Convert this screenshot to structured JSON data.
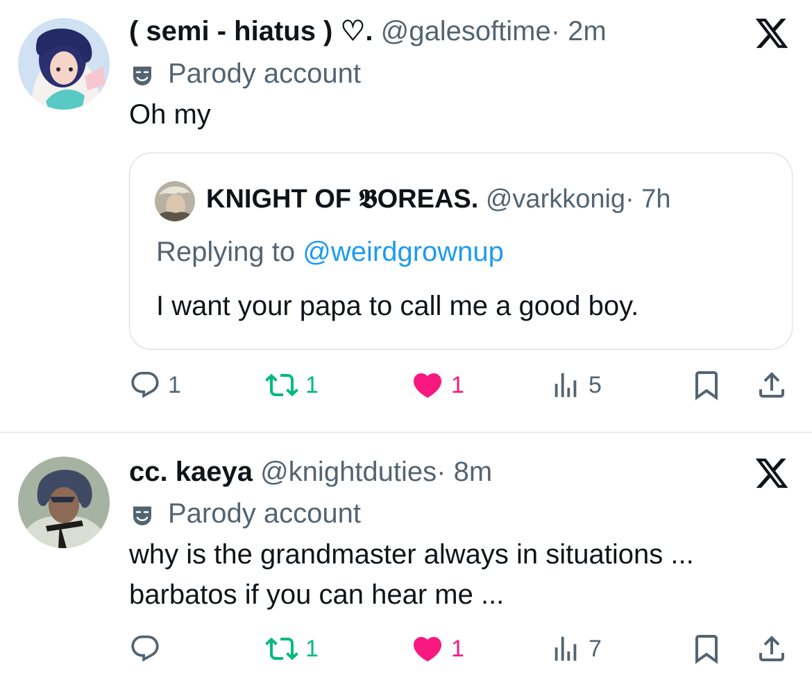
{
  "posts": [
    {
      "display_name": "( semi - hiatus ) ♡.",
      "handle": "@galesoftime",
      "time": "· 2m",
      "badge": "Parody account",
      "text_lines": [
        "Oh my"
      ],
      "avatar_icon": "avatar-icon",
      "quote": {
        "display_name": "KNIGHT OF 𝕭OREAS.",
        "handle": "@varkkonig",
        "time": "· 7h",
        "replying_prefix": "Replying to",
        "replying_to": "@weirdgrownup",
        "text": "I want your papa to call me a good boy."
      },
      "stats": {
        "replies": "1",
        "reposts": "1",
        "likes": "1",
        "views": "5"
      }
    },
    {
      "display_name": "cc. kaeya",
      "handle": "@knightduties",
      "time": "· 8m",
      "badge": "Parody account",
      "text_lines": [
        "why is the grandmaster always in situations ...",
        "barbatos if you can hear me ..."
      ],
      "avatar_icon": "avatar-icon",
      "stats": {
        "replies": "",
        "reposts": "1",
        "likes": "1",
        "views": "7"
      }
    }
  ],
  "colors": {
    "repost": "#00ba7c",
    "like": "#f91880",
    "link": "#1d9bf0",
    "muted": "#536471",
    "border": "#cfd9de"
  }
}
